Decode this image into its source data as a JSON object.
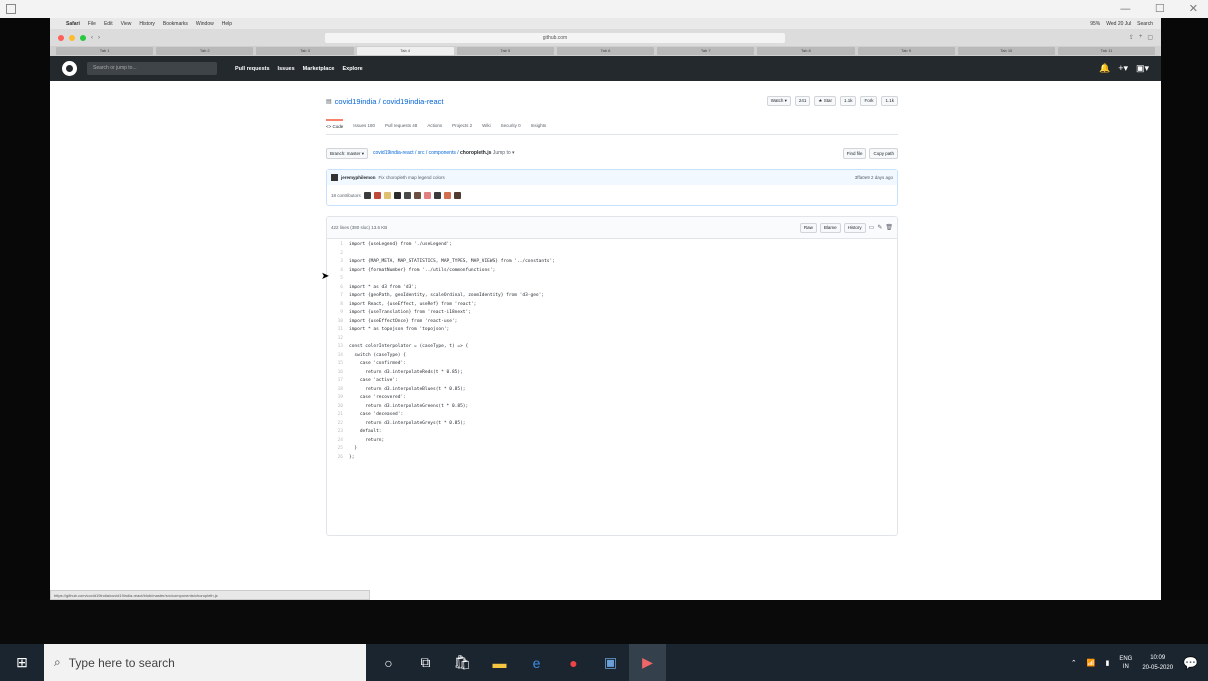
{
  "window_controls": [
    "—",
    "☐",
    "✕"
  ],
  "mac_menubar": {
    "apple": "",
    "items": [
      "Safari",
      "File",
      "Edit",
      "View",
      "History",
      "Bookmarks",
      "Window",
      "Help"
    ],
    "right": [
      "95%",
      "Wed 20 Jul",
      "Search"
    ]
  },
  "browser": {
    "url": "github.com",
    "bookmarks": [
      "Tab 1",
      "Tab 2",
      "Tab 3",
      "Tab 4",
      "Tab 5",
      "Tab 6",
      "Tab 7",
      "Tab 8",
      "Tab 9",
      "Tab 10",
      "Tab 11"
    ]
  },
  "github": {
    "search_placeholder": "Search or jump to...",
    "nav": [
      "Pull requests",
      "Issues",
      "Marketplace",
      "Explore"
    ],
    "header_right": [
      "🔔",
      "+▾",
      "▣▾"
    ]
  },
  "repo": {
    "title": "covid19india / covid19india-react",
    "actions": [
      "Watch ▾",
      "241",
      "★ Star",
      "1.1k",
      "Fork",
      "1.1k"
    ],
    "tabs": [
      "<> Code",
      "Issues 180",
      "Pull requests 48",
      "Actions",
      "Projects 2",
      "Wiki",
      "Security 0",
      "Insights"
    ]
  },
  "file": {
    "branch": "Branch: master ▾",
    "path_prefix": "covid19india-react / src / components /",
    "file_name": "choropleth.js",
    "jump": "Jump to ▾",
    "find_file": "Find file",
    "copy_path": "Copy path",
    "commit_author": "jeremyphilemon",
    "commit_msg": "Fix choropleth map legend colors",
    "commit_hash": "3ffa0e9  2 days ago",
    "contributors_label": "18 contributors",
    "meta": "422 lines (380 sloc)   13.6 KB",
    "buttons": [
      "Raw",
      "Blame",
      "History"
    ]
  },
  "code_lines": [
    "import {useLegend} from './useLegend';",
    "",
    "import {MAP_META, MAP_STATISTICS, MAP_TYPES, MAP_VIEWS} from '../constants';",
    "import {formatNumber} from '../utils/commonfunctions';",
    "",
    "import * as d3 from 'd3';",
    "import {geoPath, geoIdentity, scaleOrdinal, zoomIdentity} from 'd3-geo';",
    "import React, {useEffect, useRef} from 'react';",
    "import {useTranslation} from 'react-i18next';",
    "import {useEffectOnce} from 'react-use';",
    "import * as topojson from 'topojson';",
    "",
    "const colorInterpolator = (caseType, t) => {",
    "  switch (caseType) {",
    "    case 'confirmed':",
    "      return d3.interpolateReds(t * 0.85);",
    "    case 'active':",
    "      return d3.interpolateBlues(t * 0.85);",
    "    case 'recovered':",
    "      return d3.interpolateGreens(t * 0.85);",
    "    case 'deceased':",
    "      return d3.interpolateGreys(t * 0.85);",
    "    default:",
    "      return;",
    "  }",
    "};"
  ],
  "status_url": "https://github.com/covid19india/covid19india-react/blob/master/src/components/choropleth.js",
  "taskbar": {
    "search_placeholder": "Type here to search",
    "lang": [
      "ENG",
      "IN"
    ],
    "time": "10:09",
    "date": "20-05-2020"
  }
}
